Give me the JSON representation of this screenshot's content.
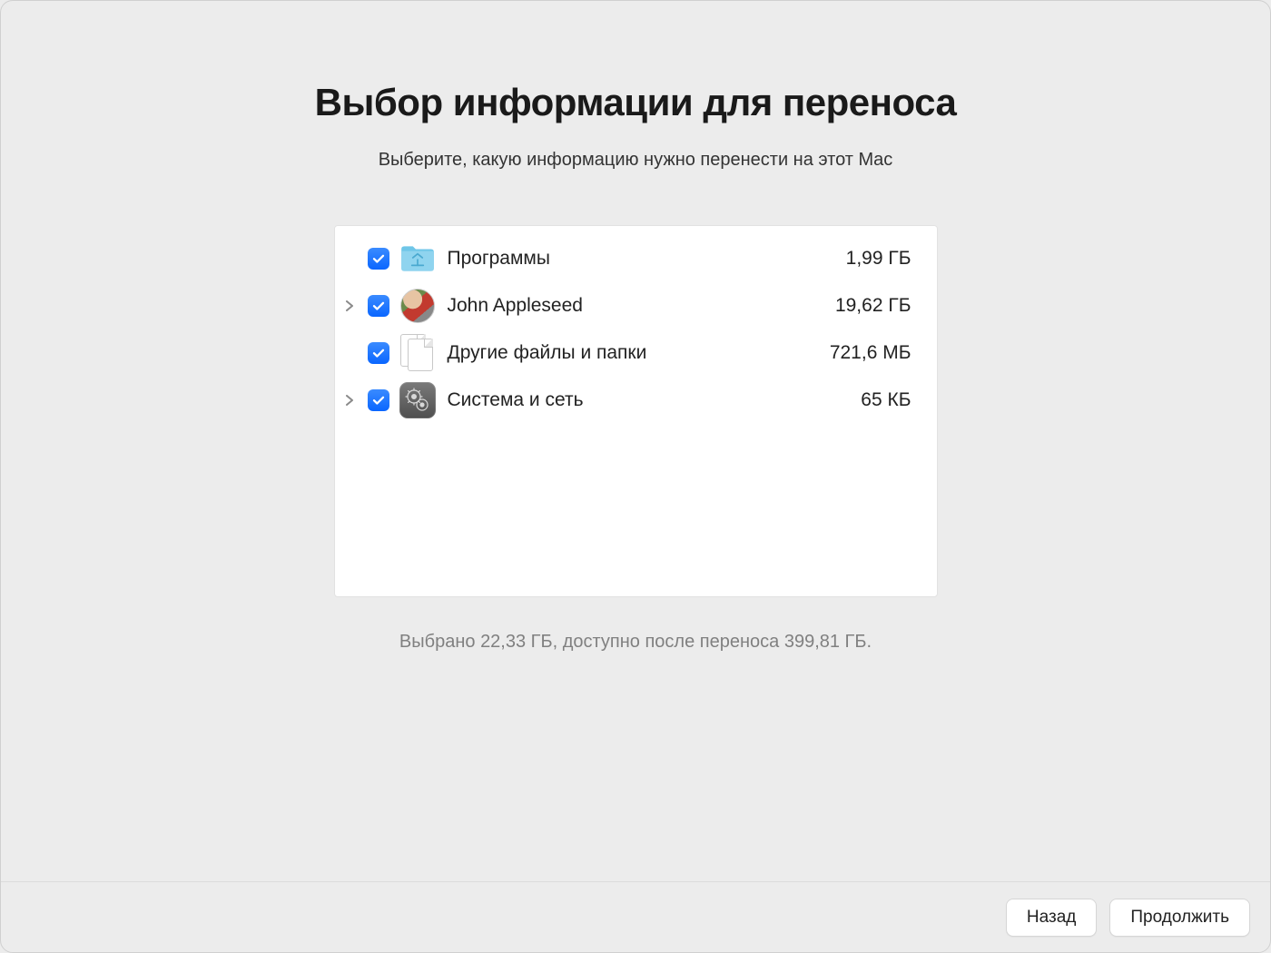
{
  "title": "Выбор информации для переноса",
  "subtitle": "Выберите, какую информацию нужно перенести на этот Mac",
  "items": [
    {
      "label": "Программы",
      "size": "1,99 ГБ",
      "checked": true,
      "expandable": false,
      "icon": "apps-folder"
    },
    {
      "label": "John Appleseed",
      "size": "19,62 ГБ",
      "checked": true,
      "expandable": true,
      "icon": "user-avatar"
    },
    {
      "label": "Другие файлы и папки",
      "size": "721,6 МБ",
      "checked": true,
      "expandable": false,
      "icon": "documents"
    },
    {
      "label": "Система и сеть",
      "size": "65 КБ",
      "checked": true,
      "expandable": true,
      "icon": "system-settings"
    }
  ],
  "summary": "Выбрано 22,33 ГБ, доступно после переноса 399,81 ГБ.",
  "buttons": {
    "back": "Назад",
    "continue": "Продолжить"
  }
}
